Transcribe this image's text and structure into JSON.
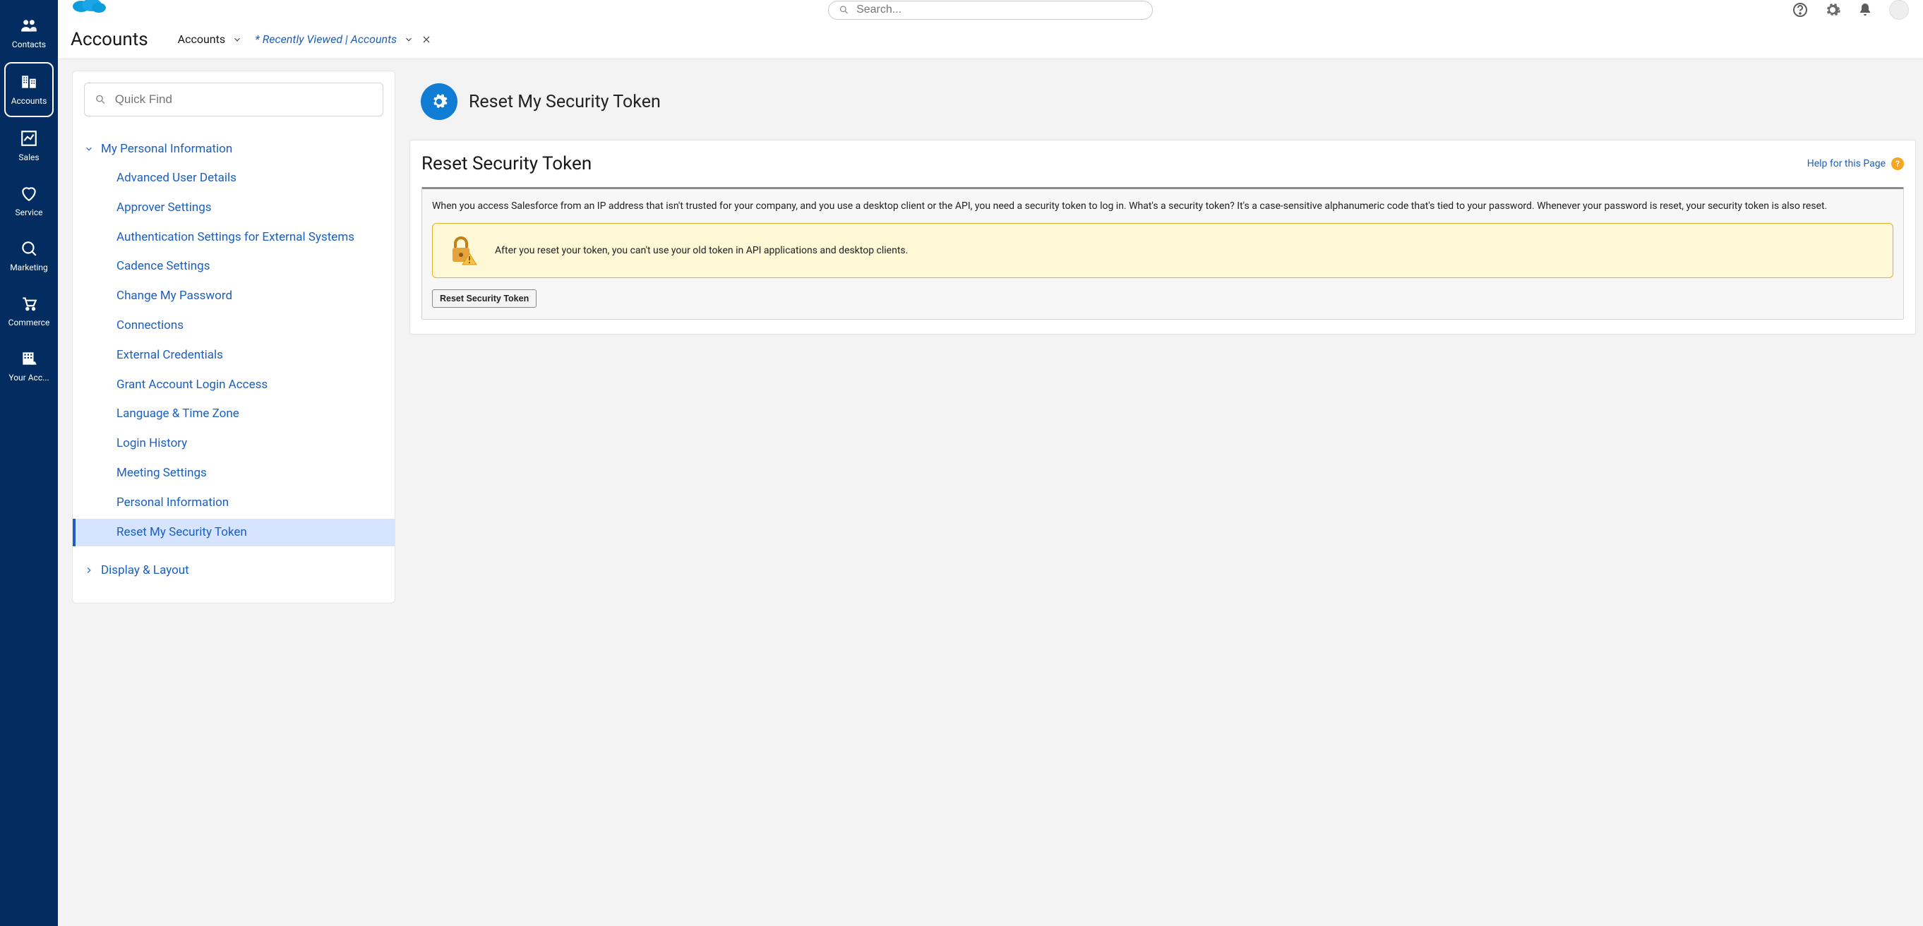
{
  "vnav": {
    "items": [
      {
        "label": "Contacts"
      },
      {
        "label": "Accounts"
      },
      {
        "label": "Sales"
      },
      {
        "label": "Service"
      },
      {
        "label": "Marketing"
      },
      {
        "label": "Commerce"
      },
      {
        "label": "Your Acc..."
      }
    ]
  },
  "topbar": {
    "search_placeholder": "Search..."
  },
  "subnav": {
    "title": "Accounts",
    "crumb1": "Accounts",
    "crumb2": "* Recently Viewed | Accounts"
  },
  "tree": {
    "quickfind_placeholder": "Quick Find",
    "section1": {
      "label": "My Personal Information",
      "items": [
        "Advanced User Details",
        "Approver Settings",
        "Authentication Settings for External Systems",
        "Cadence Settings",
        "Change My Password",
        "Connections",
        "External Credentials",
        "Grant Account Login Access",
        "Language & Time Zone",
        "Login History",
        "Meeting Settings",
        "Personal Information",
        "Reset My Security Token"
      ]
    },
    "section2": {
      "label": "Display & Layout"
    }
  },
  "detail": {
    "page_title": "Reset My Security Token",
    "card_title": "Reset Security Token",
    "help_label": "Help for this Page",
    "description": "When you access Salesforce from an IP address that isn't trusted for your company, and you use a desktop client or the API, you need a security token to log in. What's a security token? It's a case-sensitive alphanumeric code that's tied to your password. Whenever your password is reset, your security token is also reset.",
    "warning": "After you reset your token, you can't use your old token in API applications and desktop clients.",
    "button_label": "Reset Security Token"
  }
}
